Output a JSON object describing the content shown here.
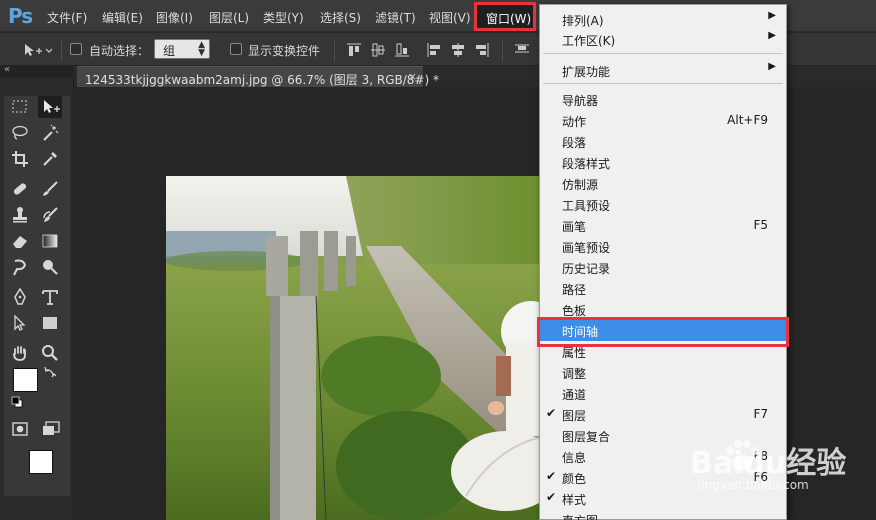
{
  "app": {
    "logo": "Ps"
  },
  "menubar": {
    "items": [
      "文件(F)",
      "编辑(E)",
      "图像(I)",
      "图层(L)",
      "类型(Y)",
      "选择(S)",
      "滤镜(T)",
      "视图(V)"
    ],
    "active": "窗口(W)"
  },
  "options": {
    "auto_select_label": "自动选择：",
    "group_value": "组",
    "transform_label": "显示变换控件"
  },
  "tabs": {
    "collapse": "«",
    "doc_title": "124533tkjjggkwaabm2amj.jpg @ 66.7% (图层 3, RGB/8#) *",
    "close": "×"
  },
  "window_menu": {
    "items": [
      {
        "label": "排列(A)",
        "shortcut": "",
        "submenu": true,
        "checked": false
      },
      {
        "label": "工作区(K)",
        "shortcut": "",
        "submenu": true,
        "checked": false
      },
      {
        "label": "扩展功能",
        "shortcut": "",
        "submenu": true,
        "checked": false
      },
      {
        "label": "导航器",
        "shortcut": "",
        "submenu": false,
        "checked": false
      },
      {
        "label": "动作",
        "shortcut": "Alt+F9",
        "submenu": false,
        "checked": false
      },
      {
        "label": "段落",
        "shortcut": "",
        "submenu": false,
        "checked": false
      },
      {
        "label": "段落样式",
        "shortcut": "",
        "submenu": false,
        "checked": false
      },
      {
        "label": "仿制源",
        "shortcut": "",
        "submenu": false,
        "checked": false
      },
      {
        "label": "工具预设",
        "shortcut": "",
        "submenu": false,
        "checked": false
      },
      {
        "label": "画笔",
        "shortcut": "F5",
        "submenu": false,
        "checked": false
      },
      {
        "label": "画笔预设",
        "shortcut": "",
        "submenu": false,
        "checked": false
      },
      {
        "label": "历史记录",
        "shortcut": "",
        "submenu": false,
        "checked": false
      },
      {
        "label": "路径",
        "shortcut": "",
        "submenu": false,
        "checked": false
      },
      {
        "label": "色板",
        "shortcut": "",
        "submenu": false,
        "checked": false
      },
      {
        "label": "时间轴",
        "shortcut": "",
        "submenu": false,
        "checked": false,
        "highlighted": true
      },
      {
        "label": "属性",
        "shortcut": "",
        "submenu": false,
        "checked": false
      },
      {
        "label": "调整",
        "shortcut": "",
        "submenu": false,
        "checked": false
      },
      {
        "label": "通道",
        "shortcut": "",
        "submenu": false,
        "checked": false
      },
      {
        "label": "图层",
        "shortcut": "F7",
        "submenu": false,
        "checked": true
      },
      {
        "label": "图层复合",
        "shortcut": "",
        "submenu": false,
        "checked": false
      },
      {
        "label": "信息",
        "shortcut": "F8",
        "submenu": false,
        "checked": false
      },
      {
        "label": "颜色",
        "shortcut": "F6",
        "submenu": false,
        "checked": true
      },
      {
        "label": "样式",
        "shortcut": "",
        "submenu": false,
        "checked": true
      },
      {
        "label": "直方图",
        "shortcut": "",
        "submenu": false,
        "checked": false
      }
    ]
  },
  "watermark": {
    "brand": "Baidu经验",
    "url": "jingyan.baidu.com"
  },
  "colors": {
    "menu_highlight": "#3d8ee8",
    "annotation_red": "#e8333c",
    "ps_blue": "#5ca6e6"
  }
}
